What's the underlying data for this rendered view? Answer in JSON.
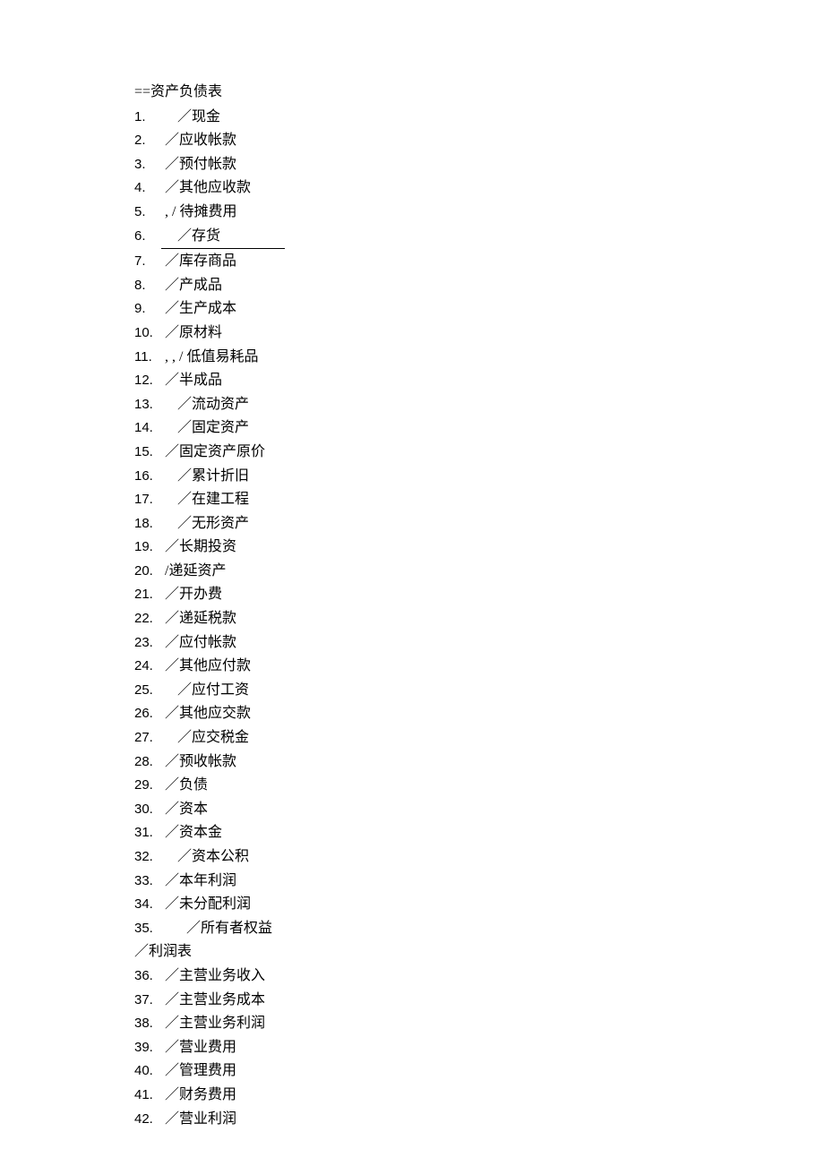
{
  "heading": "==资产负债表",
  "items": [
    {
      "num": "1.",
      "indent": 1,
      "text": "／现金"
    },
    {
      "num": "2.",
      "indent": 0,
      "text": "／应收帐款"
    },
    {
      "num": "3.",
      "indent": 0,
      "text": "／预付帐款"
    },
    {
      "num": "4.",
      "indent": 0,
      "text": "／其他应收款"
    },
    {
      "num": "5.",
      "indent": 0,
      "text": ", / 待摊费用"
    },
    {
      "num": "6.",
      "indent": 1,
      "text": "／存货",
      "underline": true
    },
    {
      "num": "7.",
      "indent": 0,
      "text": "／库存商品"
    },
    {
      "num": "8.",
      "indent": 0,
      "text": "／产成品"
    },
    {
      "num": "9.",
      "indent": 0,
      "text": "／生产成本"
    },
    {
      "num": "10.",
      "indent": 0,
      "text": "／原材料"
    },
    {
      "num": "11.",
      "indent": 0,
      "text": ", , / 低值易耗品"
    },
    {
      "num": "12.",
      "indent": 0,
      "text": "／半成品"
    },
    {
      "num": "13.",
      "indent": 1,
      "text": "／流动资产"
    },
    {
      "num": "14.",
      "indent": 1,
      "text": "／固定资产"
    },
    {
      "num": "15.",
      "indent": 0,
      "text": "／固定资产原价"
    },
    {
      "num": "16.",
      "indent": 1,
      "text": "／累计折旧"
    },
    {
      "num": "17.",
      "indent": 1,
      "text": "／在建工程"
    },
    {
      "num": "18.",
      "indent": 1,
      "text": "／无形资产"
    },
    {
      "num": "19.",
      "indent": 0,
      "text": "／长期投资"
    },
    {
      "num": "20.",
      "indent": 0,
      "text": "/递延资产"
    },
    {
      "num": "21.",
      "indent": 0,
      "text": "／开办费"
    },
    {
      "num": "22.",
      "indent": 0,
      "text": "／递延税款"
    },
    {
      "num": "23.",
      "indent": 0,
      "text": "／应付帐款"
    },
    {
      "num": "24.",
      "indent": 0,
      "text": "／其他应付款"
    },
    {
      "num": "25.",
      "indent": 1,
      "text": "／应付工资"
    },
    {
      "num": "26.",
      "indent": 0,
      "text": "／其他应交款"
    },
    {
      "num": "27.",
      "indent": 1,
      "text": "／应交税金"
    },
    {
      "num": "28.",
      "indent": 0,
      "text": "／预收帐款"
    },
    {
      "num": "29.",
      "indent": 0,
      "text": "／负债"
    },
    {
      "num": "30.",
      "indent": 0,
      "text": "／资本"
    },
    {
      "num": "31.",
      "indent": 0,
      "text": "／资本金"
    },
    {
      "num": "32.",
      "indent": 1,
      "text": "／资本公积"
    },
    {
      "num": "33.",
      "indent": 0,
      "text": "／本年利润"
    },
    {
      "num": "34.",
      "indent": 0,
      "text": "／未分配利润"
    },
    {
      "num": "35.",
      "indent": 2,
      "text": "／所有者权益"
    }
  ],
  "subheading": "／利润表",
  "items2": [
    {
      "num": "36.",
      "indent": 0,
      "text": "／主营业务收入"
    },
    {
      "num": "37.",
      "indent": 0,
      "text": "／主营业务成本"
    },
    {
      "num": "38.",
      "indent": 0,
      "text": "／主营业务利润"
    },
    {
      "num": "39.",
      "indent": 0,
      "text": "／营业费用"
    },
    {
      "num": "40.",
      "indent": 0,
      "text": "／管理费用"
    },
    {
      "num": "41.",
      "indent": 0,
      "text": "／财务费用"
    },
    {
      "num": "42.",
      "indent": 0,
      "text": "／营业利润"
    }
  ]
}
